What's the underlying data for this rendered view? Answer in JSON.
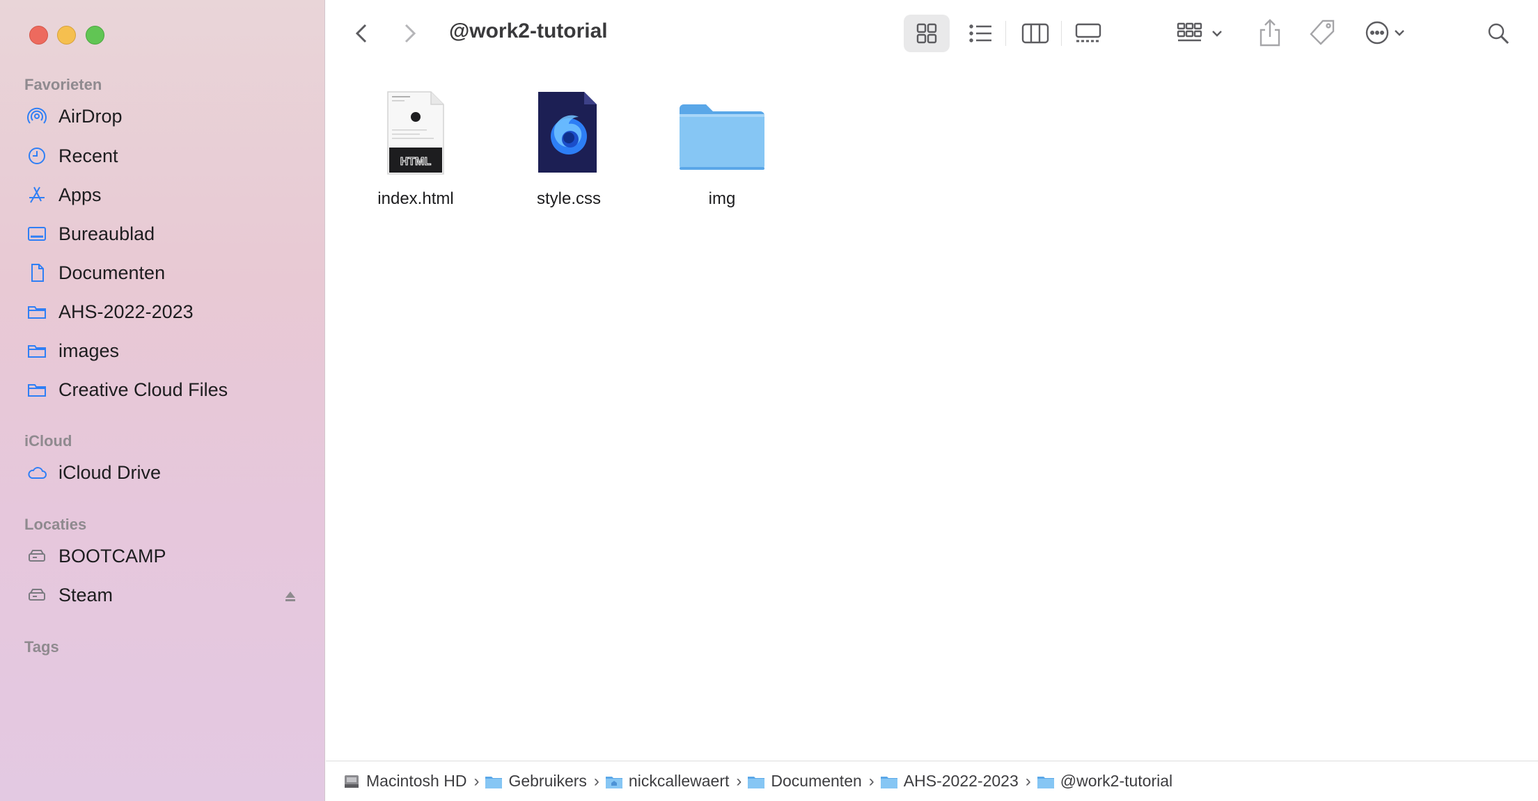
{
  "window": {
    "title": "@work2-tutorial"
  },
  "sidebar": {
    "sections": [
      {
        "title": "Favorieten",
        "items": [
          {
            "label": "AirDrop",
            "icon": "airdrop-icon"
          },
          {
            "label": "Recent",
            "icon": "clock-icon"
          },
          {
            "label": "Apps",
            "icon": "apps-icon"
          },
          {
            "label": "Bureaublad",
            "icon": "desktop-icon"
          },
          {
            "label": "Documenten",
            "icon": "document-icon"
          },
          {
            "label": "AHS-2022-2023",
            "icon": "folder-icon"
          },
          {
            "label": "images",
            "icon": "folder-icon"
          },
          {
            "label": "Creative Cloud Files",
            "icon": "folder-icon"
          }
        ]
      },
      {
        "title": "iCloud",
        "items": [
          {
            "label": "iCloud Drive",
            "icon": "cloud-icon"
          }
        ]
      },
      {
        "title": "Locaties",
        "items": [
          {
            "label": "BOOTCAMP",
            "icon": "drive-icon"
          },
          {
            "label": "Steam",
            "icon": "drive-icon"
          }
        ]
      },
      {
        "title": "Tags",
        "items": []
      }
    ]
  },
  "files": [
    {
      "name": "index.html",
      "type": "html-file-icon"
    },
    {
      "name": "style.css",
      "type": "css-file-icon"
    },
    {
      "name": "img",
      "type": "folder-icon"
    }
  ],
  "file_badges": {
    "html": "HTML"
  },
  "pathbar": [
    {
      "label": "Macintosh HD",
      "icon": "harddisk-icon"
    },
    {
      "label": "Gebruikers",
      "icon": "folder-icon"
    },
    {
      "label": "nickcallewaert",
      "icon": "home-folder-icon"
    },
    {
      "label": "Documenten",
      "icon": "folder-icon"
    },
    {
      "label": "AHS-2022-2023",
      "icon": "folder-icon"
    },
    {
      "label": "@work2-tutorial",
      "icon": "folder-icon"
    }
  ],
  "colors": {
    "accent": "#2f7ff5",
    "folder": "#6cb5ef"
  }
}
